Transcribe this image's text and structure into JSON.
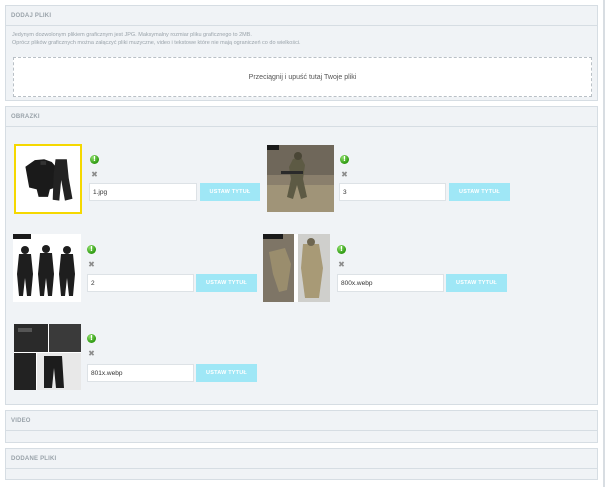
{
  "add_files": {
    "title": "DODAJ PLIKI",
    "note_line1": "Jedynym dozwolonym plikiem graficznym jest JPG. Maksymalny rozmiar pliku graficznego to 2MB.",
    "note_line2": "Oprócz plików graficznych można załączyć pliki muzyczne, video i tekstowe które nie mają ograniczeń co do wielkości.",
    "dropzone_label": "Przeciągnij i upuść tutaj Twoje pliki"
  },
  "images": {
    "title": "OBRAZKI",
    "ok_glyph": "!",
    "remove_glyph": "✖",
    "items": [
      {
        "filename": "1.jpg",
        "button_label": "USTAW TYTUŁ",
        "thumbnail": "black-tactical-uniform"
      },
      {
        "filename": "3",
        "button_label": "USTAW TYTUŁ",
        "thumbnail": "soldier-camo-field"
      },
      {
        "filename": "2",
        "button_label": "USTAW TYTUŁ",
        "thumbnail": "three-black-uniforms"
      },
      {
        "filename": "800x.webp",
        "button_label": "USTAW TYTUŁ",
        "thumbnail": "soldier-multicam-pair"
      },
      {
        "filename": "801x.webp",
        "button_label": "USTAW TYTUŁ",
        "thumbnail": "black-pants-detail-collage"
      }
    ]
  },
  "video": {
    "title": "VIDEO"
  },
  "added_files": {
    "title": "DODANE PLIKI"
  },
  "colors": {
    "panel_bg": "#f0f3f6",
    "button_bg": "#9fe7f6",
    "selected_border": "#f5d800",
    "ok_green": "#2f9a12"
  }
}
